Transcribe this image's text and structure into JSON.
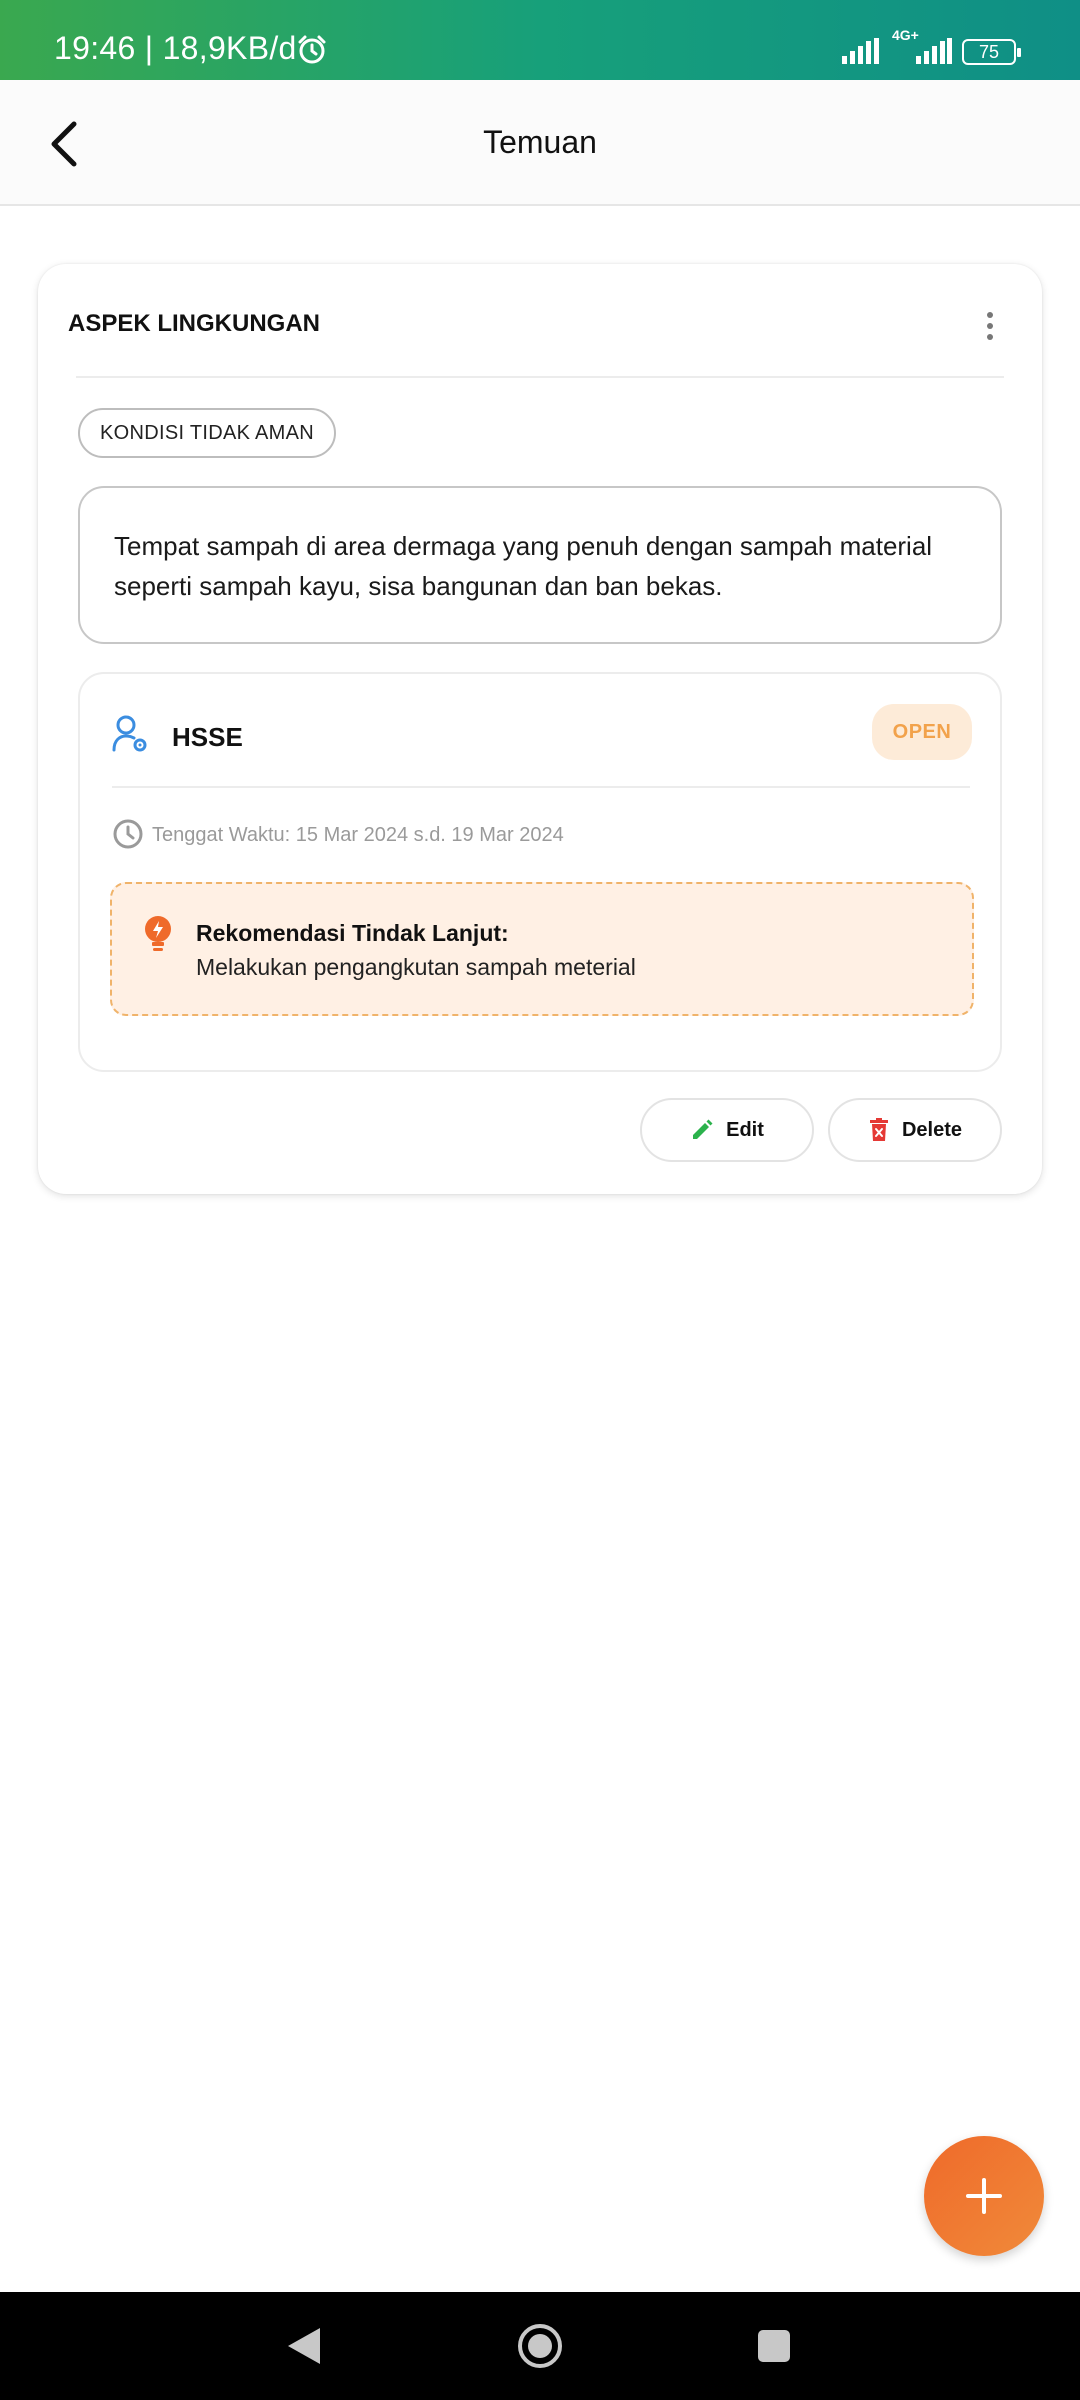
{
  "status_bar": {
    "time_speed": "19:46 | 18,9KB/d",
    "network": "4G+",
    "battery": "75",
    "icons": [
      "alarm-icon",
      "signal-icon",
      "battery-icon"
    ]
  },
  "app_bar": {
    "title": "Temuan",
    "back_icon": "chevron-left-icon"
  },
  "finding": {
    "aspect": "ASPEK LINGKUNGAN",
    "category_chip": "KONDISI TIDAK AMAN",
    "description": "Tempat sampah di area dermaga yang penuh dengan sampah material seperti sampah kayu, sisa bangunan dan ban bekas.",
    "department": "HSSE",
    "status": "OPEN",
    "deadline": "Tenggat Waktu: 15 Mar 2024 s.d. 19 Mar 2024",
    "recommendation_title": "Rekomendasi Tindak Lanjut:",
    "recommendation_text": "Melakukan pengangkutan sampah meterial"
  },
  "actions": {
    "edit_label": "Edit",
    "delete_label": "Delete"
  },
  "colors": {
    "accent_orange": "#ef6a2a",
    "status_open_bg": "#fdebd8",
    "status_open_text": "#f2a24b",
    "edit_icon": "#2bb24c",
    "delete_icon": "#e53935",
    "user_icon": "#3b8de0"
  }
}
